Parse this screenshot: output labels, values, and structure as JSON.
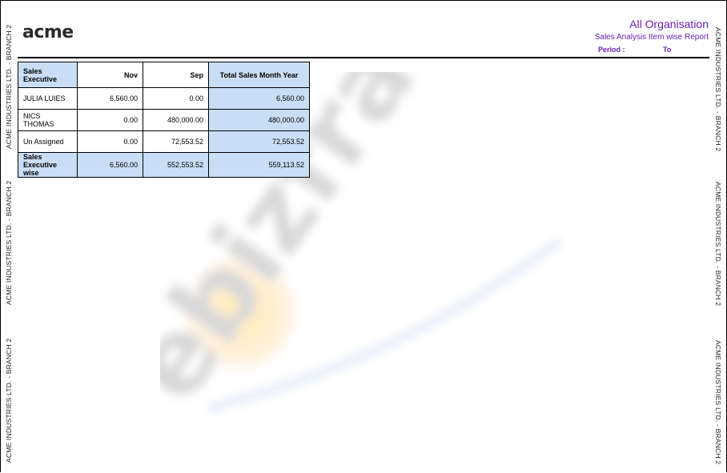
{
  "side_label": "ACME INDUSTRIES LTD. - BRANCH 2",
  "logo": "acme",
  "header": {
    "organisation": "All Organisation",
    "report_title": "Sales Analysis Item wise Report",
    "period_label": "Period :",
    "to_label": "To"
  },
  "table": {
    "headers": [
      "Sales Executive",
      "Nov",
      "Sep",
      "Total Sales Month Year"
    ],
    "rows": [
      {
        "name": "JULIA LUIES",
        "nov": "6,560.00",
        "sep": "0.00",
        "total": "6,560.00"
      },
      {
        "name": "NICS THOMAS",
        "nov": "0.00",
        "sep": "480,000.00",
        "total": "480,000.00"
      },
      {
        "name": "Un Assigned",
        "nov": "0.00",
        "sep": "72,553.52",
        "total": "72,553.52"
      }
    ],
    "footer": {
      "name": "Sales Executive wise",
      "nov": "6,560.00",
      "sep": "552,553.52",
      "total": "559,113.52"
    }
  },
  "watermark": "ebizframe",
  "colors": {
    "accent": "#6a1fb5",
    "header_fill": "#c9def5"
  }
}
